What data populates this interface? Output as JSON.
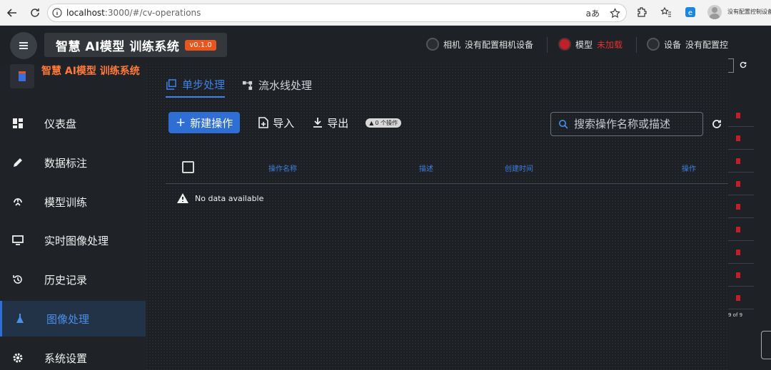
{
  "browser": {
    "url_host": "localhost",
    "url_path": ":3000/#/cv-operations",
    "read_aloud": "aあ",
    "behind_text": "没有配置控制设备"
  },
  "header": {
    "title": "智慧 AI模型 训练系统",
    "version": "v0.1.0",
    "camera_label": "相机",
    "camera_value": "没有配置相机设备",
    "model_label": "模型",
    "model_value": "未加载",
    "device_label": "设备",
    "device_value": "没有配置控"
  },
  "sidebar": {
    "brand": "智慧 AI模型 训练系统",
    "items": [
      {
        "label": "仪表盘"
      },
      {
        "label": "数据标注"
      },
      {
        "label": "模型训练"
      },
      {
        "label": "实时图像处理"
      },
      {
        "label": "历史记录"
      },
      {
        "label": "图像处理"
      },
      {
        "label": "系统设置"
      }
    ]
  },
  "main": {
    "tabs": [
      {
        "label": "单步处理"
      },
      {
        "label": "流水线处理"
      }
    ],
    "new_button": "新建操作",
    "import_button": "导入",
    "export_button": "导出",
    "count_badge": "0 个操作",
    "search_placeholder": "搜索操作名称或描述",
    "columns": [
      "操作名称",
      "描述",
      "创建时间",
      "操作"
    ],
    "empty_text": "No data available"
  },
  "strip": {
    "page_text": "9 of 9"
  },
  "colors": {
    "accent": "#2f6fd4",
    "version_badge": "#e8561e",
    "status_red": "#e03030",
    "brand": "#ff7a3a"
  }
}
